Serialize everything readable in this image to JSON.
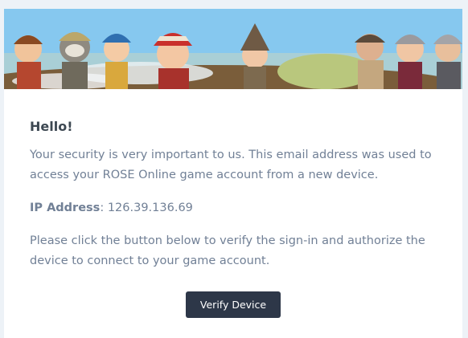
{
  "banner": {
    "image": "rose-online-characters-banner"
  },
  "email": {
    "greeting": "Hello!",
    "intro": "Your security is very important to us. This email address was used to access your ROSE Online game account from a new device.",
    "ip_label": "IP Address",
    "ip_separator": ": ",
    "ip_value": "126.39.136.69",
    "instruction": "Please click the button below to verify the sign-in and authorize the device to connect to your game account.",
    "button_label": "Verify Device"
  },
  "colors": {
    "background": "#edf2f7",
    "card": "#ffffff",
    "text": "#718096",
    "heading": "#3d4852",
    "button": "#2d3748"
  }
}
